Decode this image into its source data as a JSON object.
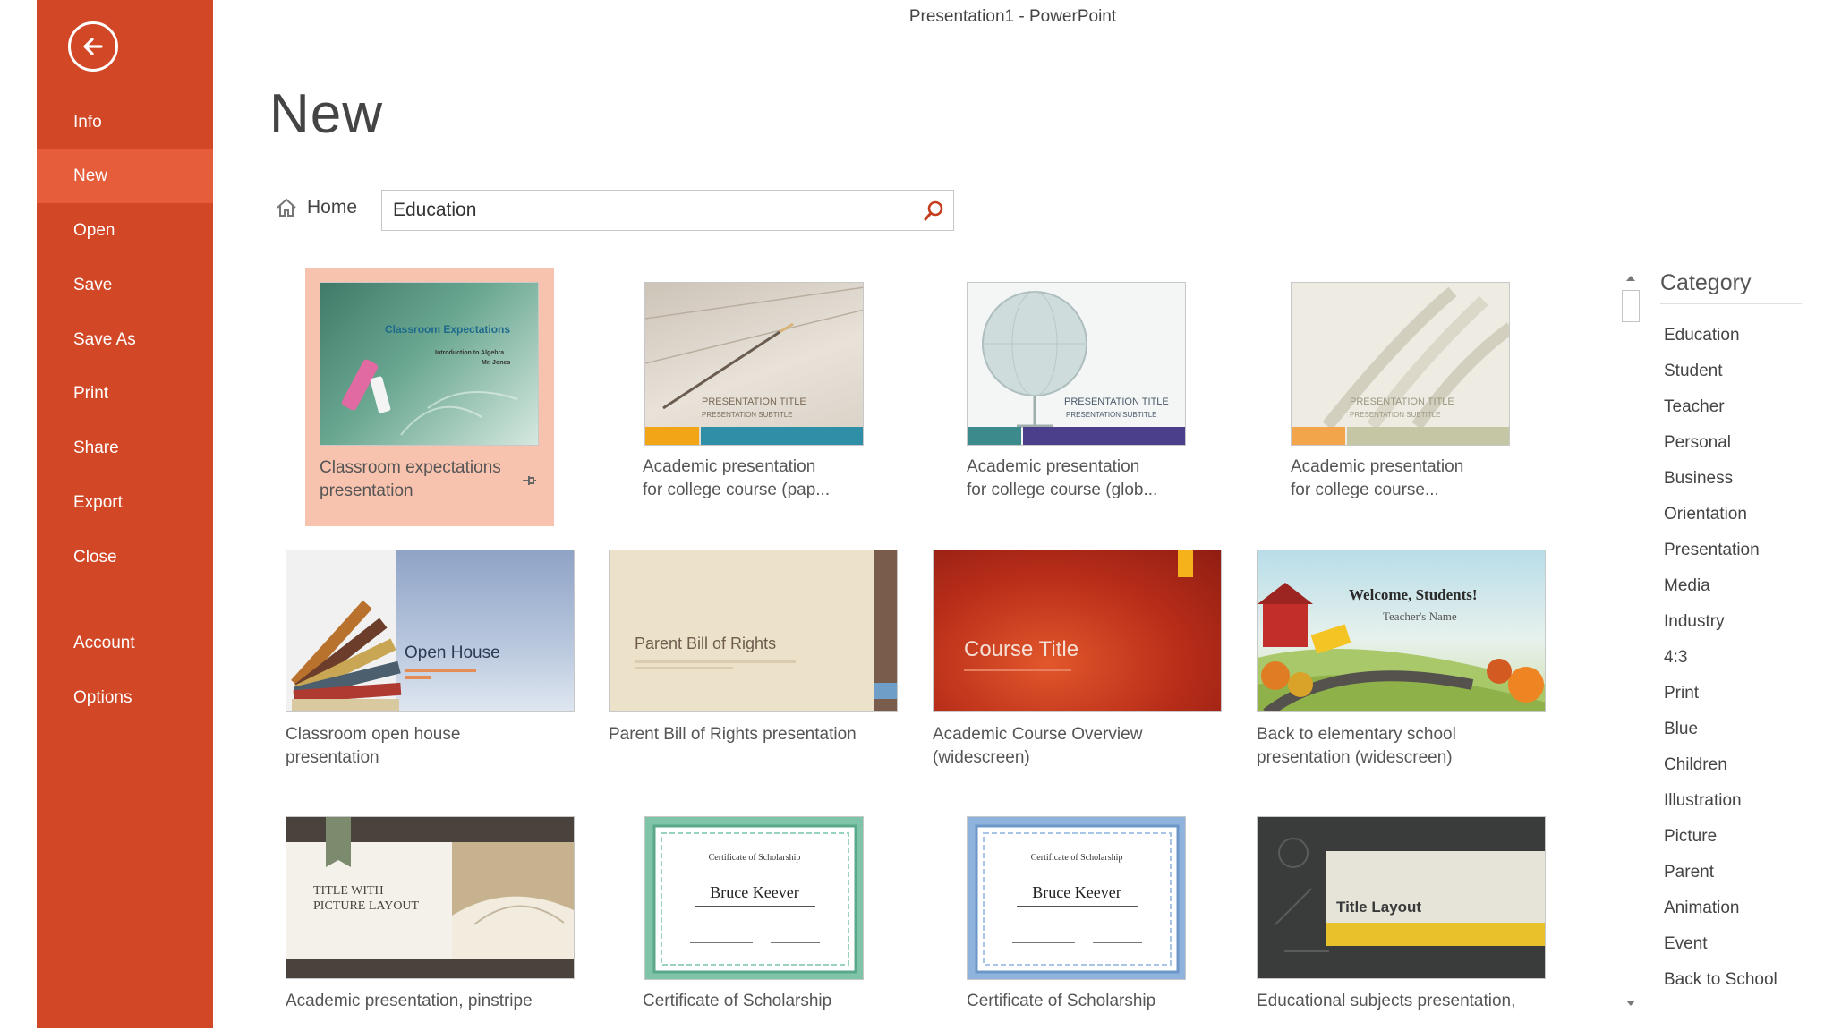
{
  "window": {
    "title": "Presentation1 - PowerPoint"
  },
  "sidebar": {
    "items": [
      {
        "label": "Info"
      },
      {
        "label": "New"
      },
      {
        "label": "Open"
      },
      {
        "label": "Save"
      },
      {
        "label": "Save As"
      },
      {
        "label": "Print"
      },
      {
        "label": "Share"
      },
      {
        "label": "Export"
      },
      {
        "label": "Close"
      },
      {
        "label": "Account"
      },
      {
        "label": "Options"
      }
    ],
    "active": "New",
    "color": "#d24726"
  },
  "page": {
    "title": "New"
  },
  "search": {
    "home_label": "Home",
    "value": "Education"
  },
  "templates": [
    {
      "caption_1": "Classroom expectations",
      "caption_2": "presentation",
      "thumb_title": "Classroom Expectations",
      "thumb_sub_1": "Introduction to Algebra",
      "thumb_sub_2": "Mr. Jones",
      "selected": true
    },
    {
      "caption_1": "Academic presentation",
      "caption_2": "for college course (pap...",
      "thumb_title": "PRESENTATION TITLE",
      "thumb_sub": "PRESENTATION SUBTITLE"
    },
    {
      "caption_1": "Academic presentation",
      "caption_2": "for college course (glob...",
      "thumb_title": "PRESENTATION TITLE",
      "thumb_sub": "PRESENTATION SUBTITLE"
    },
    {
      "caption_1": "Academic presentation",
      "caption_2": "for college course...",
      "thumb_title": "PRESENTATION TITLE",
      "thumb_sub": "PRESENTATION SUBTITLE"
    },
    {
      "caption_1": "Classroom open house",
      "caption_2": "presentation",
      "thumb_title": "Open House"
    },
    {
      "caption_1": "Parent Bill of Rights presentation",
      "caption_2": "",
      "thumb_title": "Parent Bill of Rights"
    },
    {
      "caption_1": "Academic Course Overview",
      "caption_2": "(widescreen)",
      "thumb_title": "Course Title"
    },
    {
      "caption_1": "Back to elementary school",
      "caption_2": "presentation (widescreen)",
      "thumb_title": "Welcome, Students!",
      "thumb_sub": "Teacher's Name"
    },
    {
      "caption_1": "Academic presentation, pinstripe",
      "caption_2": "",
      "thumb_title_1": "TITLE WITH",
      "thumb_title_2": "PICTURE LAYOUT"
    },
    {
      "caption_1": "Certificate of Scholarship",
      "caption_2": "",
      "thumb_title": "Certificate of Scholarship",
      "thumb_name": "Bruce Keever"
    },
    {
      "caption_1": "Certificate of Scholarship",
      "caption_2": "",
      "thumb_title": "Certificate of Scholarship",
      "thumb_name": "Bruce Keever"
    },
    {
      "caption_1": "Educational subjects presentation,",
      "caption_2": "",
      "thumb_title": "Title Layout"
    }
  ],
  "category": {
    "title": "Category",
    "items": [
      "Education",
      "Student",
      "Teacher",
      "Personal",
      "Business",
      "Orientation",
      "Presentation",
      "Media",
      "Industry",
      "4:3",
      "Print",
      "Blue",
      "Children",
      "Illustration",
      "Picture",
      "Parent",
      "Animation",
      "Event",
      "Back to School"
    ]
  }
}
